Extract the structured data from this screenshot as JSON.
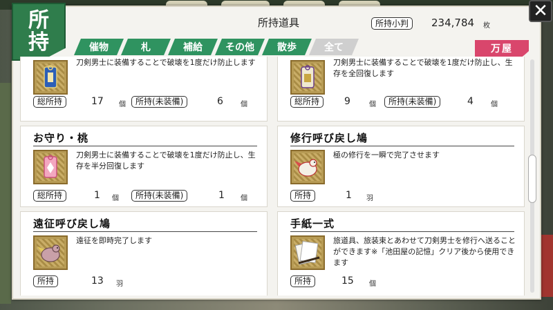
{
  "window": {
    "badge_top": "所",
    "badge_bottom": "持",
    "title": "所持道具",
    "money_label": "所持小判",
    "money_value": "234,784",
    "money_unit": "枚",
    "shop_label": "万屋",
    "close_label": "✕"
  },
  "tabs": [
    {
      "label": "催物"
    },
    {
      "label": "札"
    },
    {
      "label": "補給"
    },
    {
      "label": "その他"
    },
    {
      "label": "散歩"
    },
    {
      "label": "全て",
      "active": true
    }
  ],
  "items": [
    {
      "title": "",
      "desc": "刀剣男士に装備することで破壊を1度だけ防止します",
      "stat1_label": "総所持",
      "stat1_value": "17",
      "stat1_unit": "個",
      "stat2_label": "所持(未装備)",
      "stat2_value": "6",
      "stat2_unit": "個",
      "icon": "omamori-blue-icon"
    },
    {
      "title": "",
      "desc": "刀剣男士に装備することで破壊を1度だけ防止し、生存を全回復します",
      "stat1_label": "総所持",
      "stat1_value": "9",
      "stat1_unit": "個",
      "stat2_label": "所持(未装備)",
      "stat2_value": "4",
      "stat2_unit": "個",
      "icon": "omamori-gold-icon"
    },
    {
      "title": "お守り・桃",
      "desc": "刀剣男士に装備することで破壊を1度だけ防止し、生存を半分回復します",
      "stat1_label": "総所持",
      "stat1_value": "1",
      "stat1_unit": "個",
      "stat2_label": "所持(未装備)",
      "stat2_value": "1",
      "stat2_unit": "個",
      "icon": "omamori-peach-icon"
    },
    {
      "title": "修行呼び戻し鳩",
      "desc": "極の修行を一瞬で完了させます",
      "stat1_label": "所持",
      "stat1_value": "1",
      "stat1_unit": "羽",
      "icon": "pigeon-training-icon"
    },
    {
      "title": "遠征呼び戻し鳩",
      "desc": "遠征を即時完了します",
      "stat1_label": "所持",
      "stat1_value": "13",
      "stat1_unit": "羽",
      "icon": "pigeon-expedition-icon"
    },
    {
      "title": "手紙一式",
      "desc": "旅道具、旅装束とあわせて刀剣男士を修行へ送ることができます※「池田屋の記憶」クリア後から使用できます",
      "stat1_label": "所持",
      "stat1_value": "15",
      "stat1_unit": "個",
      "icon": "letter-set-icon"
    }
  ],
  "colors": {
    "tab_green": "#2f9360",
    "badge_green": "#2f7d4c",
    "shop_pink": "#d9466c"
  }
}
